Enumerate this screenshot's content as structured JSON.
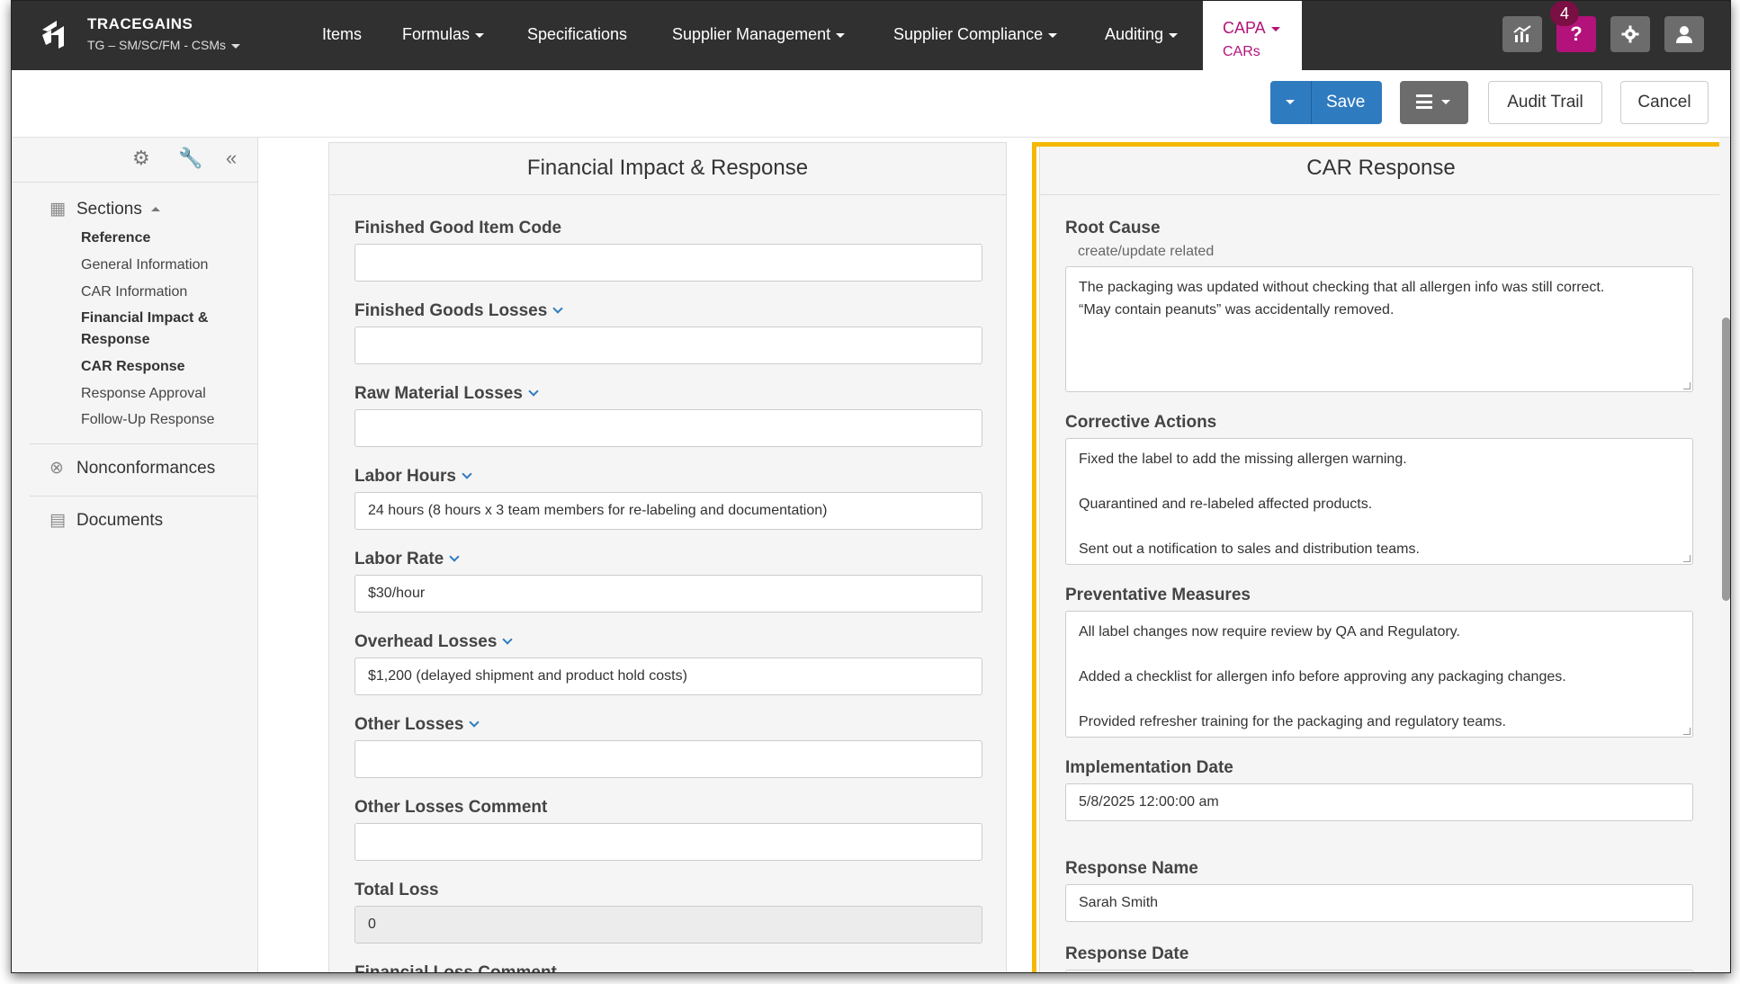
{
  "brand": {
    "name": "TRACEGAINS",
    "account": "TG – SM/SC/FM - CSMs"
  },
  "nav": {
    "items": [
      "Items",
      "Formulas",
      "Specifications",
      "Supplier Management",
      "Supplier Compliance",
      "Auditing"
    ],
    "active": {
      "label": "CAPA",
      "sub": "CARs"
    },
    "notification_count": "4",
    "help_label": "?"
  },
  "toolbar": {
    "save_label": "Save",
    "audit_label": "Audit Trail",
    "cancel_label": "Cancel"
  },
  "sidebar": {
    "sections_label": "Sections",
    "links": [
      "Reference",
      "General Information",
      "CAR Information",
      "Financial Impact & Response",
      "CAR Response",
      "Response Approval",
      "Follow-Up Response"
    ],
    "nonconformances_label": "Nonconformances",
    "documents_label": "Documents"
  },
  "financial": {
    "title": "Financial Impact & Response",
    "fields": [
      {
        "label": "Finished Good Item Code",
        "value": ""
      },
      {
        "label": "Finished Goods Losses",
        "value": ""
      },
      {
        "label": "Raw Material Losses",
        "value": ""
      },
      {
        "label": "Labor Hours",
        "value": "24 hours (8 hours x 3 team members for re-labeling and documentation)"
      },
      {
        "label": "Labor Rate",
        "value": "$30/hour"
      },
      {
        "label": "Overhead Losses",
        "value": "$1,200 (delayed shipment and product hold costs)"
      },
      {
        "label": "Other Losses",
        "value": ""
      },
      {
        "label": "Other Losses Comment",
        "value": ""
      },
      {
        "label": "Total Loss",
        "value": "0"
      },
      {
        "label": "Financial Loss Comment",
        "value": ""
      }
    ]
  },
  "car_response": {
    "title": "CAR Response",
    "root_cause": {
      "label": "Root Cause",
      "hint": "create/update related",
      "value": "The packaging was updated without checking that all allergen info was still correct.\n“May contain peanuts” was accidentally removed."
    },
    "corrective_actions": {
      "label": "Corrective Actions",
      "value": "Fixed the label to add the missing allergen warning.\n\nQuarantined and re-labeled affected products.\n\nSent out a notification to sales and distribution teams."
    },
    "preventative_measures": {
      "label": "Preventative Measures",
      "value": "All label changes now require review by QA and Regulatory.\n\nAdded a checklist for allergen info before approving any packaging changes.\n\nProvided refresher training for the packaging and regulatory teams."
    },
    "implementation_date": {
      "label": "Implementation Date",
      "value": "5/8/2025 12:00:00 am"
    },
    "response_name": {
      "label": "Response Name",
      "value": "Sarah Smith"
    },
    "response_date": {
      "label": "Response Date",
      "value": ""
    }
  },
  "colors": {
    "nav_bg": "#303030",
    "accent": "#b3127a",
    "primary": "#2f7bc0",
    "highlight": "#f5b800"
  }
}
